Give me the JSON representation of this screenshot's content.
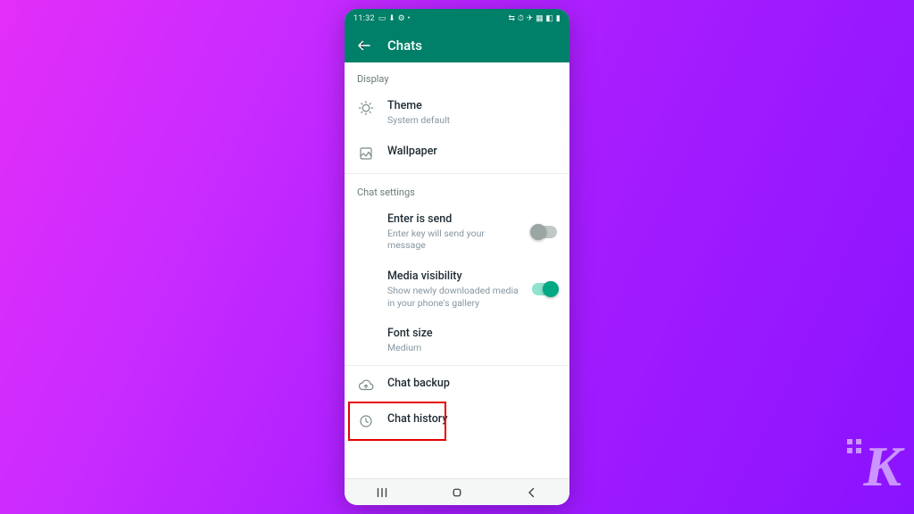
{
  "statusbar": {
    "time": "11:32",
    "left_glyphs": "▭ ⬇ ⚙ •",
    "right_glyphs": "⇆ ⏱ ✈ ▦ ◧ ▮"
  },
  "appbar": {
    "title": "Chats"
  },
  "sections": {
    "display_header": "Display",
    "theme": {
      "title": "Theme",
      "sub": "System default"
    },
    "wallpaper": {
      "title": "Wallpaper"
    },
    "chat_settings_header": "Chat settings",
    "enter_is_send": {
      "title": "Enter is send",
      "sub": "Enter key will send your message"
    },
    "media_visibility": {
      "title": "Media visibility",
      "sub": "Show newly downloaded media in your phone's gallery"
    },
    "font_size": {
      "title": "Font size",
      "sub": "Medium"
    },
    "chat_backup": {
      "title": "Chat backup"
    },
    "chat_history": {
      "title": "Chat history"
    }
  },
  "toggles": {
    "enter_is_send": false,
    "media_visibility": true
  },
  "watermark": "K"
}
